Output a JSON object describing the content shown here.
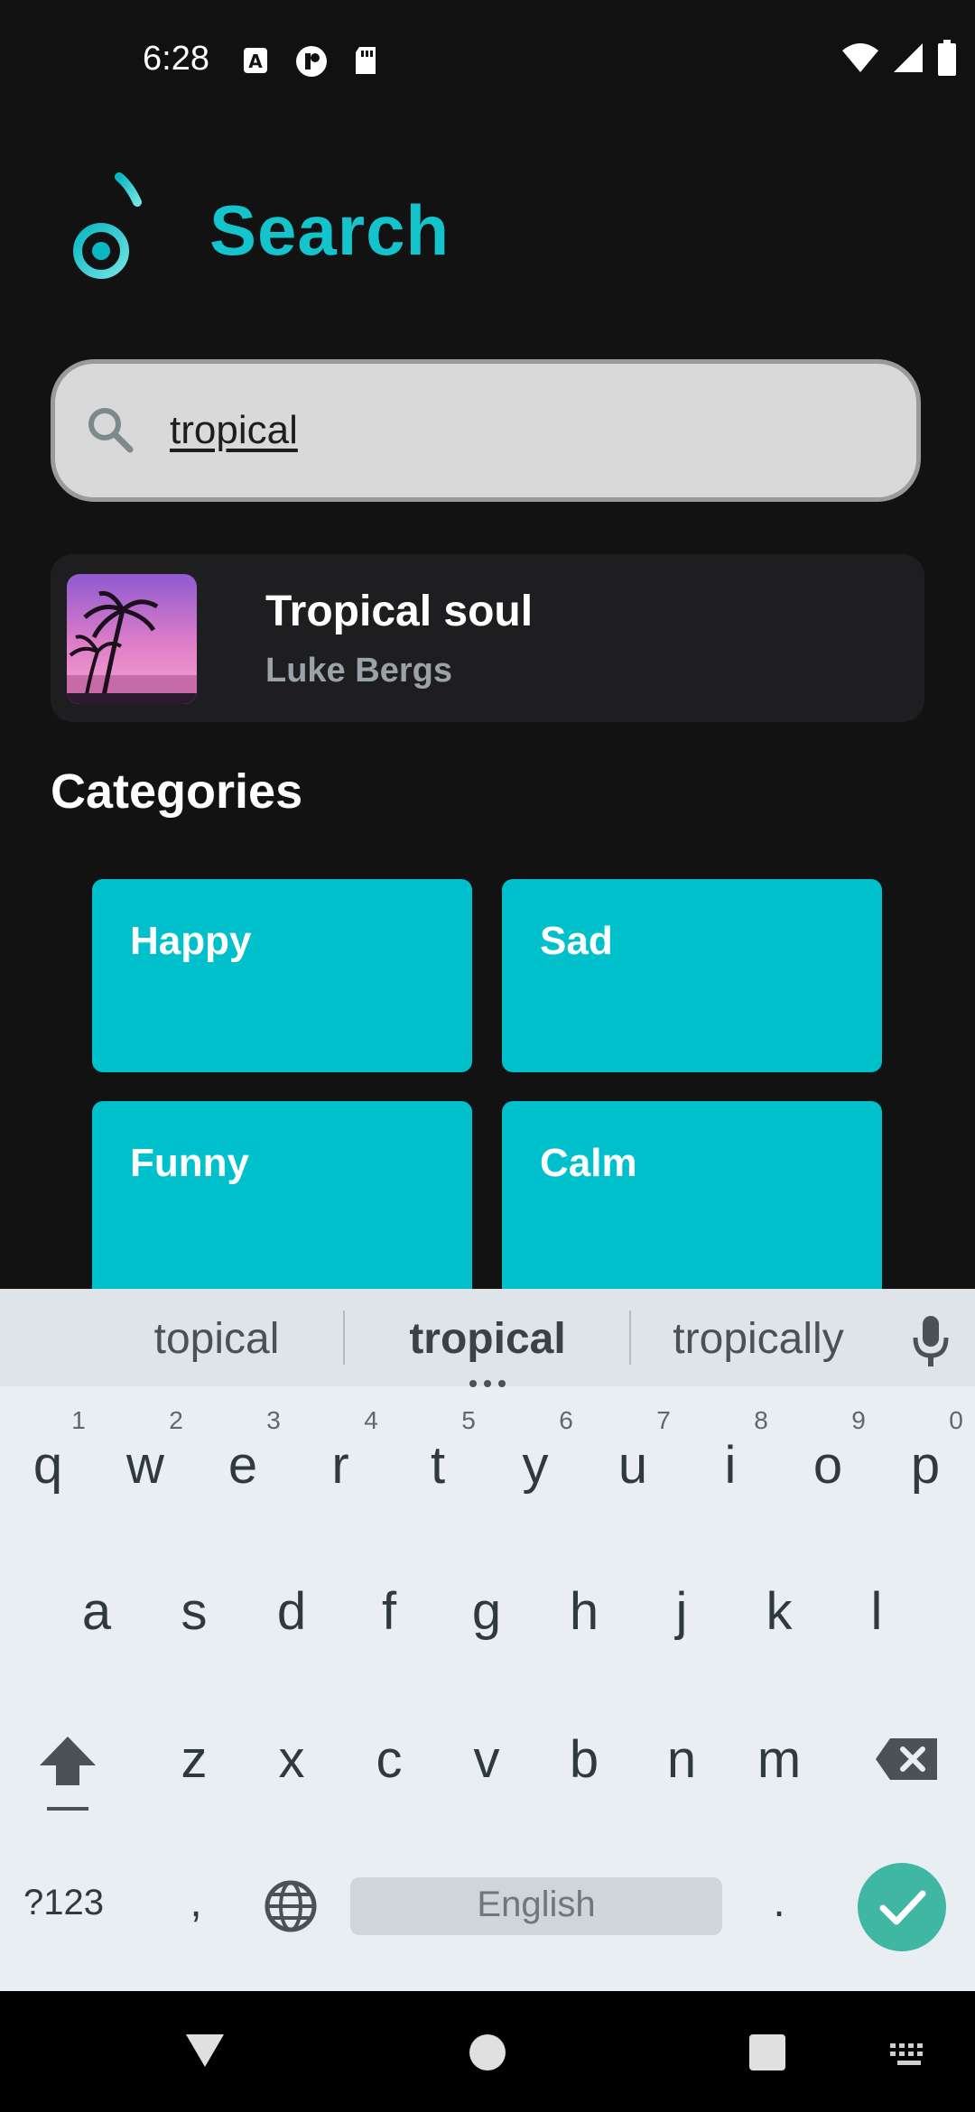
{
  "status_bar": {
    "time": "6:28"
  },
  "header": {
    "title": "Search"
  },
  "search": {
    "value": "tropical",
    "placeholder": ""
  },
  "result": {
    "title": "Tropical soul",
    "artist": "Luke Bergs"
  },
  "categories": {
    "heading": "Categories",
    "items": [
      {
        "label": "Happy"
      },
      {
        "label": "Sad"
      },
      {
        "label": "Funny"
      },
      {
        "label": "Calm"
      }
    ]
  },
  "keyboard": {
    "suggestions": [
      "topical",
      "tropical",
      "tropically"
    ],
    "row1": [
      {
        "key": "q",
        "hint": "1"
      },
      {
        "key": "w",
        "hint": "2"
      },
      {
        "key": "e",
        "hint": "3"
      },
      {
        "key": "r",
        "hint": "4"
      },
      {
        "key": "t",
        "hint": "5"
      },
      {
        "key": "y",
        "hint": "6"
      },
      {
        "key": "u",
        "hint": "7"
      },
      {
        "key": "i",
        "hint": "8"
      },
      {
        "key": "o",
        "hint": "9"
      },
      {
        "key": "p",
        "hint": "0"
      }
    ],
    "row2": [
      "a",
      "s",
      "d",
      "f",
      "g",
      "h",
      "j",
      "k",
      "l"
    ],
    "row3": [
      "z",
      "x",
      "c",
      "v",
      "b",
      "n",
      "m"
    ],
    "symbols_label": "?123",
    "comma": ",",
    "period": ".",
    "space_label": "English"
  },
  "colors": {
    "accent": "#14c4cc",
    "tile": "#00c1cb",
    "enter": "#3fb7a3"
  }
}
